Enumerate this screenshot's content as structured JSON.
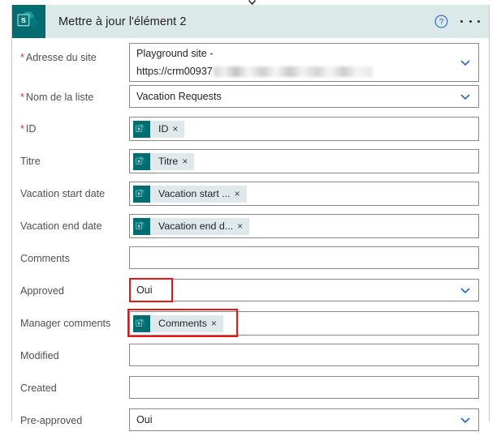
{
  "header": {
    "app_icon": "sharepoint-icon",
    "title": "Mettre à jour l'élément 2",
    "help_icon": "help-circle-icon",
    "more_icon": "ellipsis-icon",
    "brand_color": "#036c70",
    "band_color": "#dce9e9"
  },
  "colors": {
    "accent_teal": "#036c70",
    "chevron_blue": "#2564cf",
    "required_red": "#d13438",
    "annotation_red": "#ee1111",
    "token_bg": "#dfe9ec",
    "border": "#8a8886"
  },
  "form": {
    "fields": [
      {
        "label": "Adresse du site",
        "required": true,
        "type": "dropdown-two-line",
        "line1": "Playground site -",
        "line2_prefix": "https://crm00937",
        "line2_redacted": true,
        "chevron": "chevron-down-icon",
        "highlighted": false
      },
      {
        "label": "Nom de la liste",
        "required": true,
        "type": "dropdown",
        "value": "Vacation Requests",
        "chevron": "chevron-down-icon",
        "highlighted": false
      },
      {
        "label": "ID",
        "required": true,
        "type": "token",
        "token_label": "ID",
        "token_icon": "sharepoint-icon",
        "token_remove": "×",
        "highlighted": false
      },
      {
        "label": "Titre",
        "required": false,
        "type": "token",
        "token_label": "Titre",
        "token_icon": "sharepoint-icon",
        "token_remove": "×",
        "highlighted": false
      },
      {
        "label": "Vacation start date",
        "required": false,
        "type": "token",
        "token_label": "Vacation start ...",
        "token_icon": "sharepoint-icon",
        "token_remove": "×",
        "highlighted": false
      },
      {
        "label": "Vacation end date",
        "required": false,
        "type": "token",
        "token_label": "Vacation end d...",
        "token_icon": "sharepoint-icon",
        "token_remove": "×",
        "highlighted": false
      },
      {
        "label": "Comments",
        "required": false,
        "type": "text",
        "value": "",
        "highlighted": false
      },
      {
        "label": "Approved",
        "required": false,
        "type": "dropdown",
        "value": "Oui",
        "chevron": "chevron-down-icon",
        "highlighted": true
      },
      {
        "label": "Manager comments",
        "required": false,
        "type": "token",
        "token_label": "Comments",
        "token_icon": "sharepoint-icon",
        "token_remove": "×",
        "highlighted": true
      },
      {
        "label": "Modified",
        "required": false,
        "type": "text",
        "value": "",
        "highlighted": false
      },
      {
        "label": "Created",
        "required": false,
        "type": "text",
        "value": "",
        "highlighted": false
      },
      {
        "label": "Pre-approved",
        "required": false,
        "type": "dropdown",
        "value": "Oui",
        "chevron": "chevron-down-icon",
        "highlighted": false
      }
    ]
  }
}
